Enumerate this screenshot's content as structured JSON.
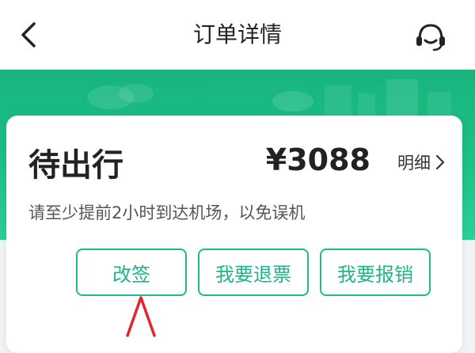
{
  "header": {
    "title": "订单详情",
    "back_icon": "chevron-left-icon",
    "service_icon": "headset-icon"
  },
  "order": {
    "status": "待出行",
    "price": "¥3088",
    "detail_label": "明细",
    "notice": "请至少提前2小时到达机场，以免误机"
  },
  "actions": {
    "change_label": "改签",
    "refund_label": "我要退票",
    "reimburse_label": "我要报销"
  },
  "colors": {
    "brand_green": "#1cc188",
    "button_border": "#21b98a",
    "annotation_red": "#e3262a"
  }
}
